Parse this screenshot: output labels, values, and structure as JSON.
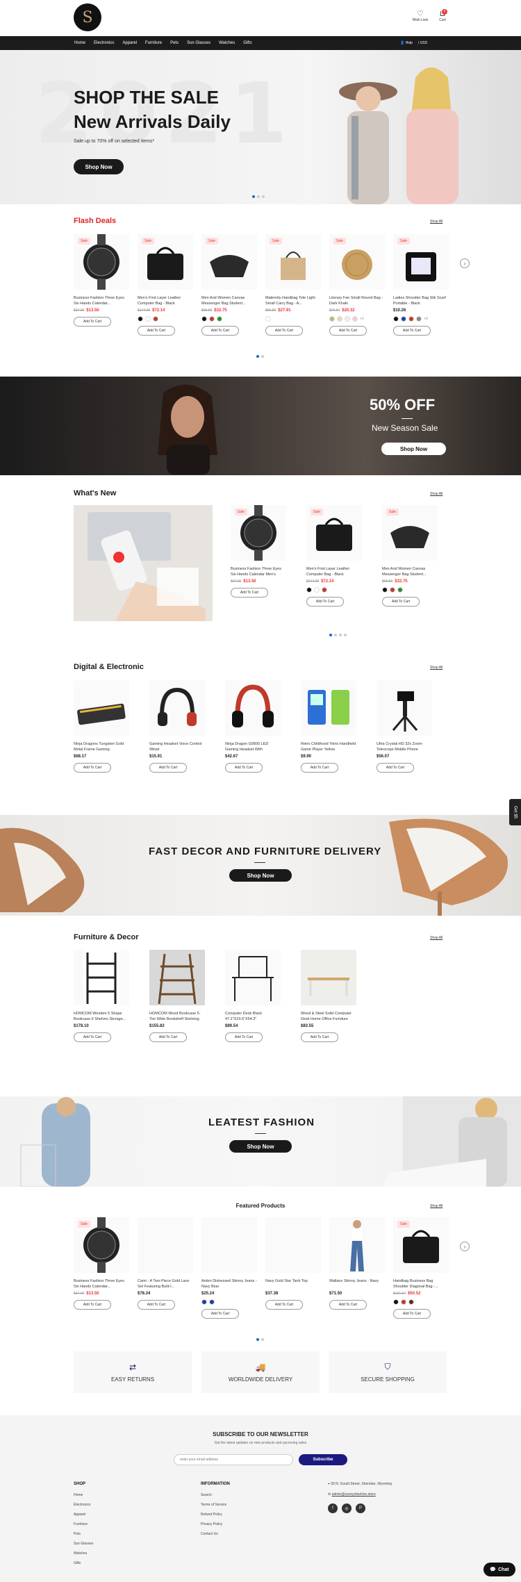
{
  "header": {
    "logo_letter": "S",
    "wishlist": "Wish Lists",
    "cart": "Cart",
    "cart_count": "0"
  },
  "nav": {
    "items": [
      "Home",
      "Electronics",
      "Apparel",
      "Furniture",
      "Pets",
      "Sun Glasses",
      "Watches",
      "Gifts"
    ],
    "help": "Help",
    "currency": "/ USD"
  },
  "hero": {
    "title": "SHOP THE SALE",
    "title2": "New Arrivals Daily",
    "subtitle": "Sale up to 70% off on selected items*",
    "button": "Shop Now",
    "bg_number": "2021"
  },
  "flash": {
    "title": "Flash Deals",
    "shop_all": "Shop All",
    "sale_badge": "Sale",
    "add": "Add To Cart",
    "products": [
      {
        "name": "Business Fashion Three Eyes Six Hands Calendar...",
        "old": "$27.00",
        "price": "$13.50",
        "colors": []
      },
      {
        "name": "Men's First Layer Leather Computer Bag - Black",
        "old": "$144.28",
        "price": "$72.14",
        "colors": [
          "#111",
          "#fff",
          "#c0392b"
        ]
      },
      {
        "name": "Men And Women Canvas Messenger Bag Student...",
        "old": "$65.50",
        "price": "$32.75",
        "colors": [
          "#111",
          "#c0392b",
          "#2e8b2e"
        ]
      },
      {
        "name": "Maternity Handbag Tote Light Small Carry Bag - A...",
        "old": "$55.82",
        "price": "$27.91",
        "colors": [
          "#fff"
        ]
      },
      {
        "name": "Literary Fan Small Round Bag - Dark Khaki",
        "old": "$40.64",
        "price": "$20.32",
        "colors": [
          "#bdb76b",
          "#e8d9a8",
          "#eee",
          "#f8c8d8"
        ],
        "more": "+1"
      },
      {
        "name": "Ladies Shoulder Bag Silk Scarf Portable - Black",
        "old": "",
        "price": "$10.26",
        "colors": [
          "#111",
          "#1f3ea8",
          "#c0392b",
          "#888"
        ],
        "more": "+3"
      }
    ]
  },
  "promo": {
    "title": "50% OFF",
    "subtitle": "New Season Sale",
    "button": "Shop Now"
  },
  "whatsnew": {
    "title": "What's New",
    "shop_all": "Shop All",
    "products": [
      {
        "name": "Business Fashion Three Eyes Six Hands Calendar Men's Watch",
        "old": "$27.00",
        "price": "$13.50",
        "colors": []
      },
      {
        "name": "Men's First Layer Leather Computer Bag - Black",
        "old": "$144.28",
        "price": "$72.14",
        "colors": [
          "#111",
          "#fff",
          "#c0392b"
        ]
      },
      {
        "name": "Men And Women Canvas Messenger Bag Student...",
        "old": "$65.50",
        "price": "$32.75",
        "colors": [
          "#111",
          "#c0392b",
          "#2e8b2e"
        ]
      }
    ]
  },
  "digital": {
    "title": "Digital & Electronic",
    "shop_all": "Shop All",
    "products": [
      {
        "name": "Ninja Dragons Tungsten Gold Metal Frame Gaming Keyboard...",
        "price": "$68.17"
      },
      {
        "name": "Gaming Headset Voice Control Wired",
        "price": "$15.91"
      },
      {
        "name": "Ninja Dragon G9500 LED Gaming Headset With Microphone",
        "price": "$42.67"
      },
      {
        "name": "Retro Childhood Tetris Handheld Game Player Yellow",
        "price": "$9.90"
      },
      {
        "name": "Ultra Crystal HD 32x Zoom Telescope Mobile Phone Camer...",
        "price": "$56.07"
      }
    ]
  },
  "decor": {
    "title": "FAST DECOR AND FURNITURE DELIVERY",
    "button": "Shop Now"
  },
  "furniture": {
    "title": "Furniture & Decor",
    "shop_all": "Shop All",
    "products": [
      {
        "name": "HOMCOM Wooden 5 Shape Bookcase 6 Shelves Storage...",
        "price": "$178.10"
      },
      {
        "name": "HOMCOM Wood Bookcase 5-Tier Wide Bookshelf Shelving Storag...",
        "price": "$155.82"
      },
      {
        "name": "Computer Desk Black 47.2\"X23.6\"X54.3\"",
        "price": "$89.54"
      },
      {
        "name": "Wood & Steel Solid Computer Desk Home Office Furniture",
        "price": "$83.55"
      }
    ]
  },
  "fashion": {
    "title": "LEATEST FASHION",
    "button": "Shop Now"
  },
  "featured": {
    "title": "Featured Products",
    "shop_all": "Shop All",
    "products": [
      {
        "name": "Business Fashion Three Eyes Six Hands Calendar...",
        "old": "$27.00",
        "price": "$13.50",
        "colors": []
      },
      {
        "name": "Cami - A Two-Piece Gold Lace Set Featuring Built-I...",
        "price": "$78.34",
        "colors": []
      },
      {
        "name": "Arden Distressed Skinny Jeans - Navy Blue",
        "price": "$25.24",
        "colors": [
          "#1f3ea8",
          "#1f3ea8"
        ]
      },
      {
        "name": "Navy Gold Star Tank Top",
        "price": "$37.38",
        "colors": []
      },
      {
        "name": "Wallace Skinny Jeans - Navy",
        "price": "$71.50",
        "colors": []
      },
      {
        "name": "Handbag Business Bag Shoulder Diagonal Bag -...",
        "old": "$101.04",
        "price": "$50.52",
        "colors": [
          "#111",
          "#c0392b",
          "#5a2a1a"
        ]
      }
    ]
  },
  "features": [
    "EASY RETURNS",
    "WORLDWIDE DELIVERY",
    "SECURE SHOPPING"
  ],
  "newsletter": {
    "title": "SUBSCRIBE TO OUR NEWSLETTER",
    "subtitle": "Get the latest updates on new products and upcoming sales",
    "placeholder": "enter your email address",
    "button": "Subscribe"
  },
  "footer": {
    "shop_title": "SHOP",
    "shop": [
      "Home",
      "Electronics",
      "Apparel",
      "Furniture",
      "Pets",
      "Sun Glasses",
      "Watches",
      "Gifts"
    ],
    "info_title": "INFORMATION",
    "info": [
      "Search",
      "Terms of Service",
      "Refund Policy",
      "Privacy Policy",
      "Contact Us"
    ],
    "address": "30 N. Gould Street, Sheridan, Wyoming",
    "email": "admin@sunnysfashion.store"
  },
  "side_tab": "Get $5",
  "chat": "Chat"
}
